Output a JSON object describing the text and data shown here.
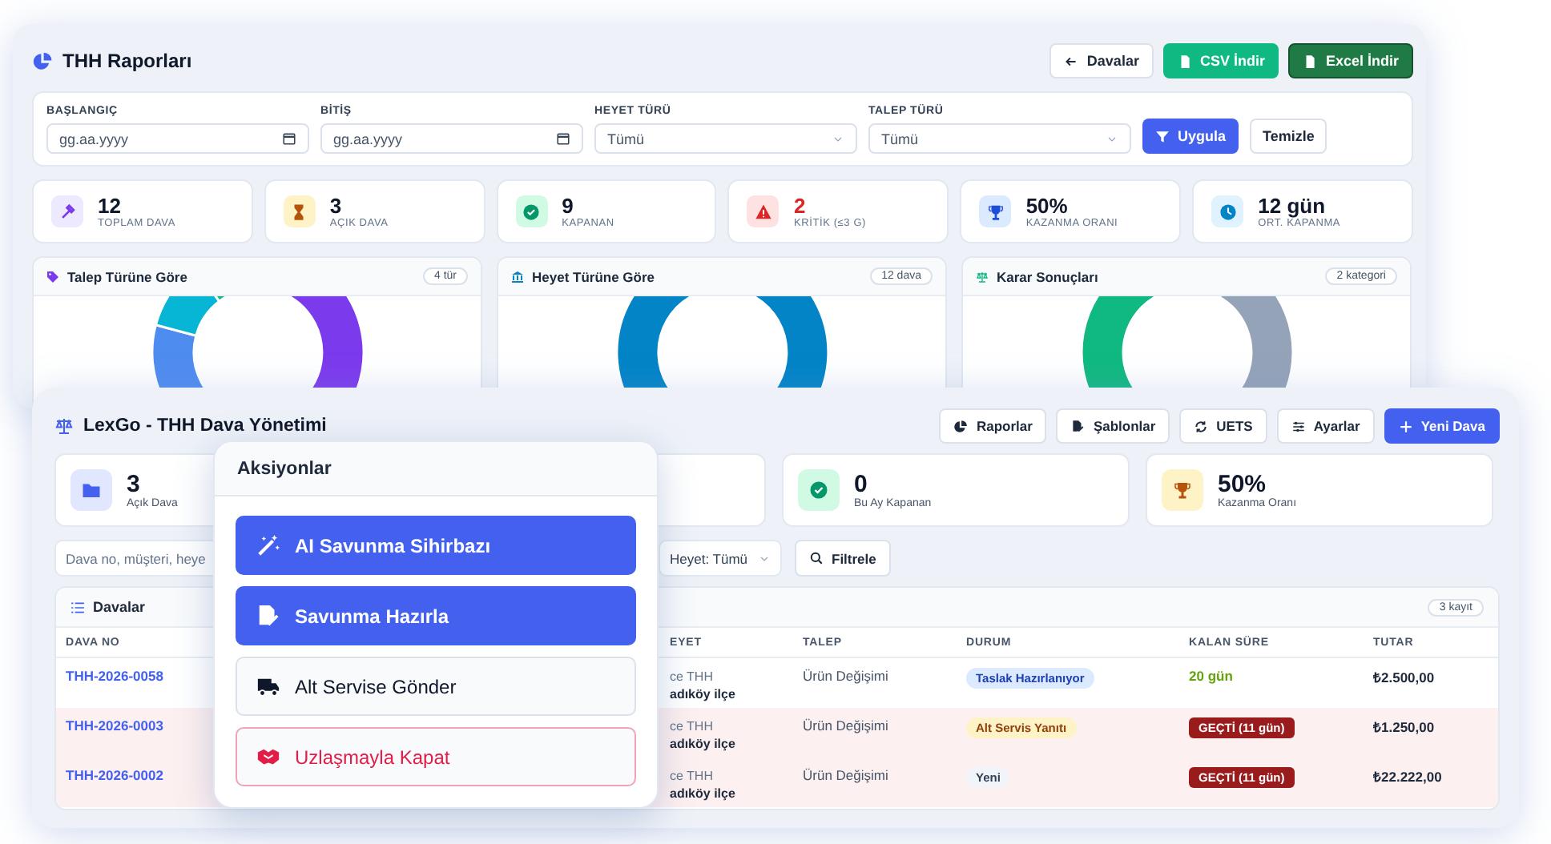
{
  "reports_window": {
    "title": "THH Raporları",
    "header_buttons": [
      {
        "label": "Davalar",
        "kind": "back"
      },
      {
        "label": "CSV İndir",
        "kind": "csv"
      },
      {
        "label": "Excel İndir",
        "kind": "excel"
      }
    ],
    "filters": [
      {
        "label": "BAŞLANGIÇ",
        "kind": "date",
        "placeholder": "gg.aa.yyyy"
      },
      {
        "label": "BİTİŞ",
        "kind": "date",
        "placeholder": "gg.aa.yyyy"
      },
      {
        "label": "HEYET TÜRÜ",
        "kind": "select",
        "value": "Tümü"
      },
      {
        "label": "TALEP TÜRÜ",
        "kind": "select",
        "value": "Tümü"
      }
    ],
    "filter_buttons": [
      {
        "label": "Uygula",
        "kind": "primary"
      },
      {
        "label": "Temizle",
        "kind": "secondary"
      }
    ],
    "stats": [
      {
        "value": "12",
        "label": "TOPLAM DAVA",
        "kind": "total"
      },
      {
        "value": "3",
        "label": "AÇIK DAVA",
        "kind": "open"
      },
      {
        "value": "9",
        "label": "KAPANAN",
        "kind": "closed"
      },
      {
        "value": "2",
        "label": "KRİTİK (≤3 G)",
        "kind": "critical"
      },
      {
        "value": "50%",
        "label": "KAZANMA ORANI",
        "kind": "win"
      },
      {
        "value": "12 gün",
        "label": "ORT. KAPANMA",
        "kind": "time"
      }
    ],
    "charts": [
      {
        "title": "Talep Türüne Göre",
        "badge": "4 tür",
        "kind": "talep"
      },
      {
        "title": "Heyet Türüne Göre",
        "badge": "12 dava",
        "kind": "heyet"
      },
      {
        "title": "Karar Sonuçları",
        "badge": "2 kategori",
        "kind": "karar"
      }
    ]
  },
  "main_window": {
    "title": "LexGo - THH Dava Yönetimi",
    "toolbar": [
      {
        "label": "Raporlar",
        "kind": "reports"
      },
      {
        "label": "Şablonlar",
        "kind": "templates"
      },
      {
        "label": "UETS",
        "kind": "uets"
      },
      {
        "label": "Ayarlar",
        "kind": "settings"
      },
      {
        "label": "Yeni Dava",
        "kind": "add"
      }
    ],
    "stats": [
      {
        "value": "3",
        "label": "Açık Dava",
        "kind": "open"
      },
      {
        "value": "0",
        "label": "Bu Ay Kapanan",
        "kind": "closed"
      },
      {
        "value": "50%",
        "label": "Kazanma Oranı",
        "kind": "win"
      }
    ],
    "search": {
      "placeholder": "Dava no, müşteri, heye"
    },
    "heyet_filter": {
      "value": "Heyet: Tümü"
    },
    "filter_button": "Filtrele",
    "table": {
      "title": "Davalar",
      "count": "3 kayıt",
      "columns": [
        "DAVA NO",
        "EYET",
        "TALEP",
        "DURUM",
        "KALAN SÜRE",
        "TUTAR"
      ],
      "rows": [
        {
          "dava_no": "THH-2026-0058",
          "heyet": [
            "ce THH",
            "adıköy ilçe"
          ],
          "talep": "Ürün Değişimi",
          "durum": {
            "text": "Taslak Hazırlanıyor",
            "kind": "draft"
          },
          "kalan": {
            "text": "20 gün",
            "overdue": false
          },
          "tutar": "₺2.500,00",
          "overdue": false
        },
        {
          "dava_no": "THH-2026-0003",
          "heyet": [
            "ce THH",
            "adıköy ilçe"
          ],
          "talep": "Ürün Değişimi",
          "durum": {
            "text": "Alt Servis Yanıtı",
            "kind": "waiting"
          },
          "kalan": {
            "text": "GEÇTİ (11 gün)",
            "overdue": true
          },
          "tutar": "₺1.250,00",
          "overdue": true
        },
        {
          "dava_no": "THH-2026-0002",
          "heyet": [
            "ce THH",
            "adıköy ilçe"
          ],
          "talep": "Ürün Değişimi",
          "durum": {
            "text": "Yeni",
            "kind": "new"
          },
          "kalan": {
            "text": "GEÇTİ (11 gün)",
            "overdue": true
          },
          "tutar": "₺22.222,00",
          "overdue": true
        }
      ]
    }
  },
  "actions_popup": {
    "title": "Aksiyonlar",
    "actions": [
      {
        "label": "AI Savunma Sihirbazı",
        "kind": "ai_wizard"
      },
      {
        "label": "Savunma Hazırla",
        "kind": "prepare"
      },
      {
        "label": "Alt Servise Gönder",
        "kind": "send"
      },
      {
        "label": "Uzlaşmayla Kapat",
        "kind": "settle"
      }
    ]
  }
}
